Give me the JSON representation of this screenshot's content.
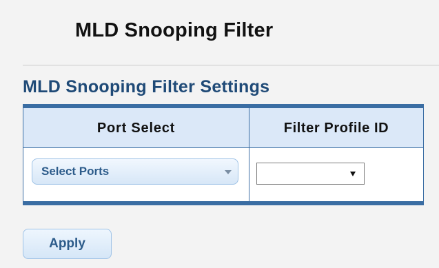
{
  "page": {
    "title": "MLD Snooping Filter"
  },
  "settings": {
    "section_title": "MLD Snooping Filter Settings",
    "columns": [
      "Port Select",
      "Filter Profile ID"
    ],
    "port_select": {
      "value": "Select Ports",
      "icon": "chevron-down-icon"
    },
    "filter_profile": {
      "value": "",
      "icon": "dropdown-arrow-icon"
    }
  },
  "actions": {
    "apply_label": "Apply"
  },
  "colors": {
    "accent": "#3a6da3",
    "section_title": "#1f4a77",
    "header_bg": "#dbe8f8",
    "button_text": "#2c5b8a"
  }
}
